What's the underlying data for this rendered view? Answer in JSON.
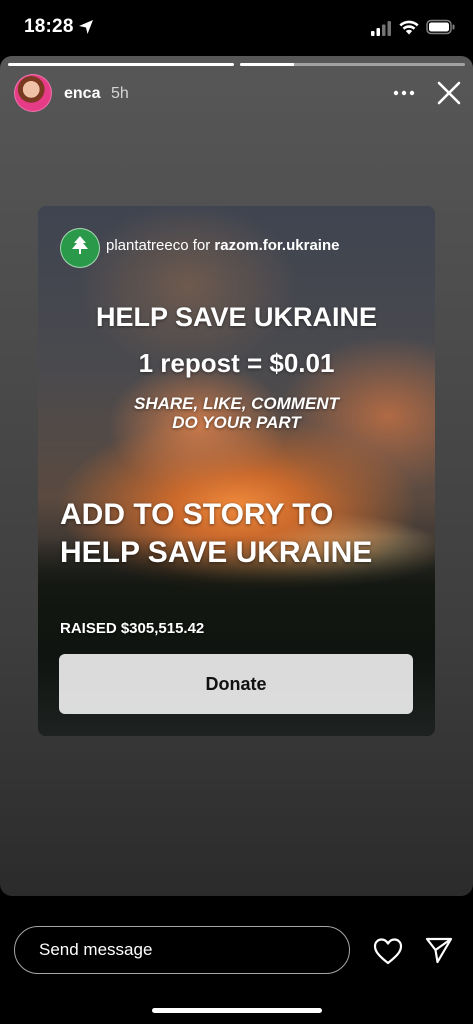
{
  "status_bar": {
    "time": "18:28",
    "icons": [
      "location-arrow-icon",
      "cellular-signal-icon",
      "wifi-icon",
      "battery-icon"
    ]
  },
  "story": {
    "progress_segments": [
      {
        "state": "complete",
        "fill": 1.0
      },
      {
        "state": "active",
        "fill": 0.24
      }
    ],
    "header": {
      "username": "enca",
      "time_ago": "5h",
      "more_icon": "ellipsis-icon",
      "close_icon": "close-icon"
    },
    "post": {
      "account": "plantatreeco",
      "for_text": "for",
      "partner": "razom.for.ukraine",
      "headline": "HELP SAVE UKRAINE",
      "repost_line": "1 repost = $0.01",
      "share_line_1": "SHARE, LIKE, COMMENT",
      "share_line_2": "DO YOUR PART",
      "sticker_title": "ADD TO STORY TO HELP SAVE UKRAINE",
      "raised": "RAISED $305,515.42",
      "donate_label": "Donate"
    }
  },
  "bottom_bar": {
    "message_placeholder": "Send message",
    "like_icon": "heart-icon",
    "share_icon": "paper-plane-icon"
  },
  "colors": {
    "background": "#000000",
    "story_gradient_top": "#575757",
    "story_gradient_bottom": "#2b2b2b",
    "logo_green": "#2a9a4a",
    "donate_button": "#ebebeb"
  }
}
